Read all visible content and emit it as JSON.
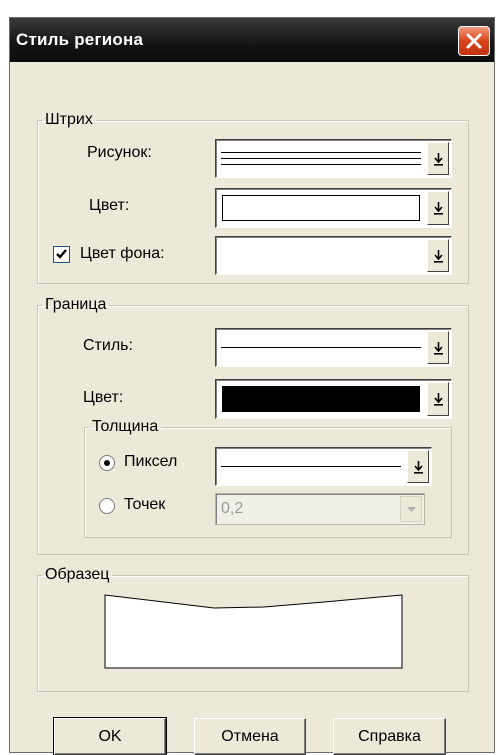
{
  "dialog": {
    "title": "Стиль региона",
    "close_icon": "close-icon"
  },
  "stroke": {
    "legend": "Штрих",
    "pattern_label": "Рисунок:",
    "color_label": "Цвет:",
    "bg_color_label": "Цвет фона:",
    "bg_color_checked": true,
    "color_value": "#ffffff"
  },
  "border": {
    "legend": "Граница",
    "style_label": "Стиль:",
    "color_label": "Цвет:",
    "color_value": "#000000",
    "thickness": {
      "legend": "Толщина",
      "pixel_label": "Пиксел",
      "point_label": "Точек",
      "point_value": "0,2",
      "selected": "pixel"
    }
  },
  "sample": {
    "legend": "Образец"
  },
  "buttons": {
    "ok": "OK",
    "cancel": "Отмена",
    "help": "Справка"
  }
}
